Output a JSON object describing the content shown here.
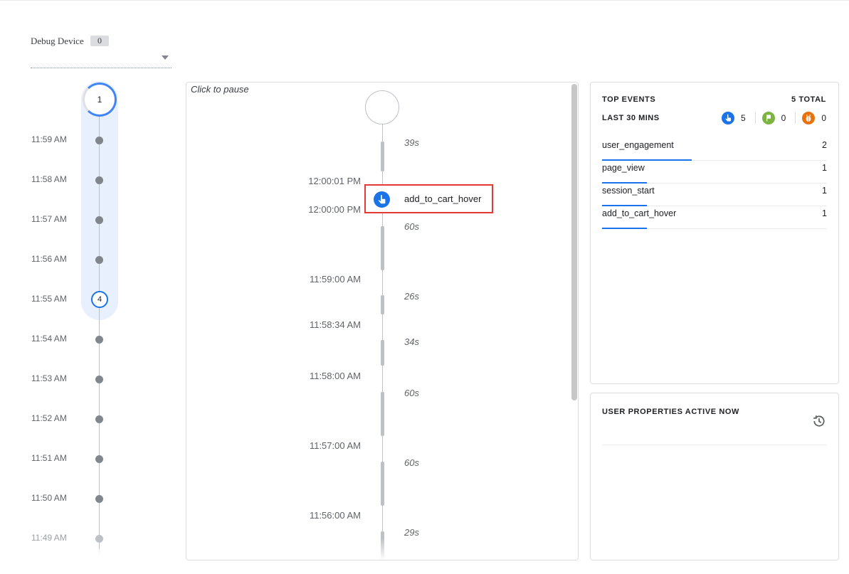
{
  "debug_device": {
    "label": "Debug Device",
    "count": "0",
    "selected": ""
  },
  "minutes": {
    "top_count": "1",
    "rows": [
      {
        "time": "11:59 AM",
        "badge": ""
      },
      {
        "time": "11:58 AM",
        "badge": ""
      },
      {
        "time": "11:57 AM",
        "badge": ""
      },
      {
        "time": "11:56 AM",
        "badge": ""
      },
      {
        "time": "11:55 AM",
        "badge": "4"
      },
      {
        "time": "11:54 AM",
        "badge": ""
      },
      {
        "time": "11:53 AM",
        "badge": ""
      },
      {
        "time": "11:52 AM",
        "badge": ""
      },
      {
        "time": "11:51 AM",
        "badge": ""
      },
      {
        "time": "11:50 AM",
        "badge": ""
      },
      {
        "time": "11:49 AM",
        "badge": ""
      }
    ]
  },
  "stream": {
    "pause_label": "Click to pause",
    "gaps": [
      "39s",
      "60s",
      "26s",
      "34s",
      "60s",
      "60s",
      "29s"
    ],
    "times": [
      "12:00:01 PM",
      "12:00:00 PM",
      "11:59:00 AM",
      "11:58:34 AM",
      "11:58:00 AM",
      "11:57:00 AM",
      "11:56:00 AM"
    ],
    "event": {
      "name": "add_to_cart_hover",
      "icon": "touch-icon"
    }
  },
  "top_events": {
    "title": "TOP EVENTS",
    "total": "5 TOTAL",
    "subtitle": "LAST 30 MINS",
    "counts": [
      {
        "icon": "touch-icon",
        "value": "5",
        "color": "#1a73e8"
      },
      {
        "icon": "flag-icon",
        "value": "0",
        "color": "#7cb342"
      },
      {
        "icon": "bug-icon",
        "value": "0",
        "color": "#e8710a"
      }
    ],
    "events": [
      {
        "name": "user_engagement",
        "value": "2",
        "fraction": 0.4
      },
      {
        "name": "page_view",
        "value": "1",
        "fraction": 0.2
      },
      {
        "name": "session_start",
        "value": "1",
        "fraction": 0.2
      },
      {
        "name": "add_to_cart_hover",
        "value": "1",
        "fraction": 0.2
      }
    ]
  },
  "user_properties": {
    "title": "USER PROPERTIES ACTIVE NOW",
    "icon": "history-icon"
  }
}
